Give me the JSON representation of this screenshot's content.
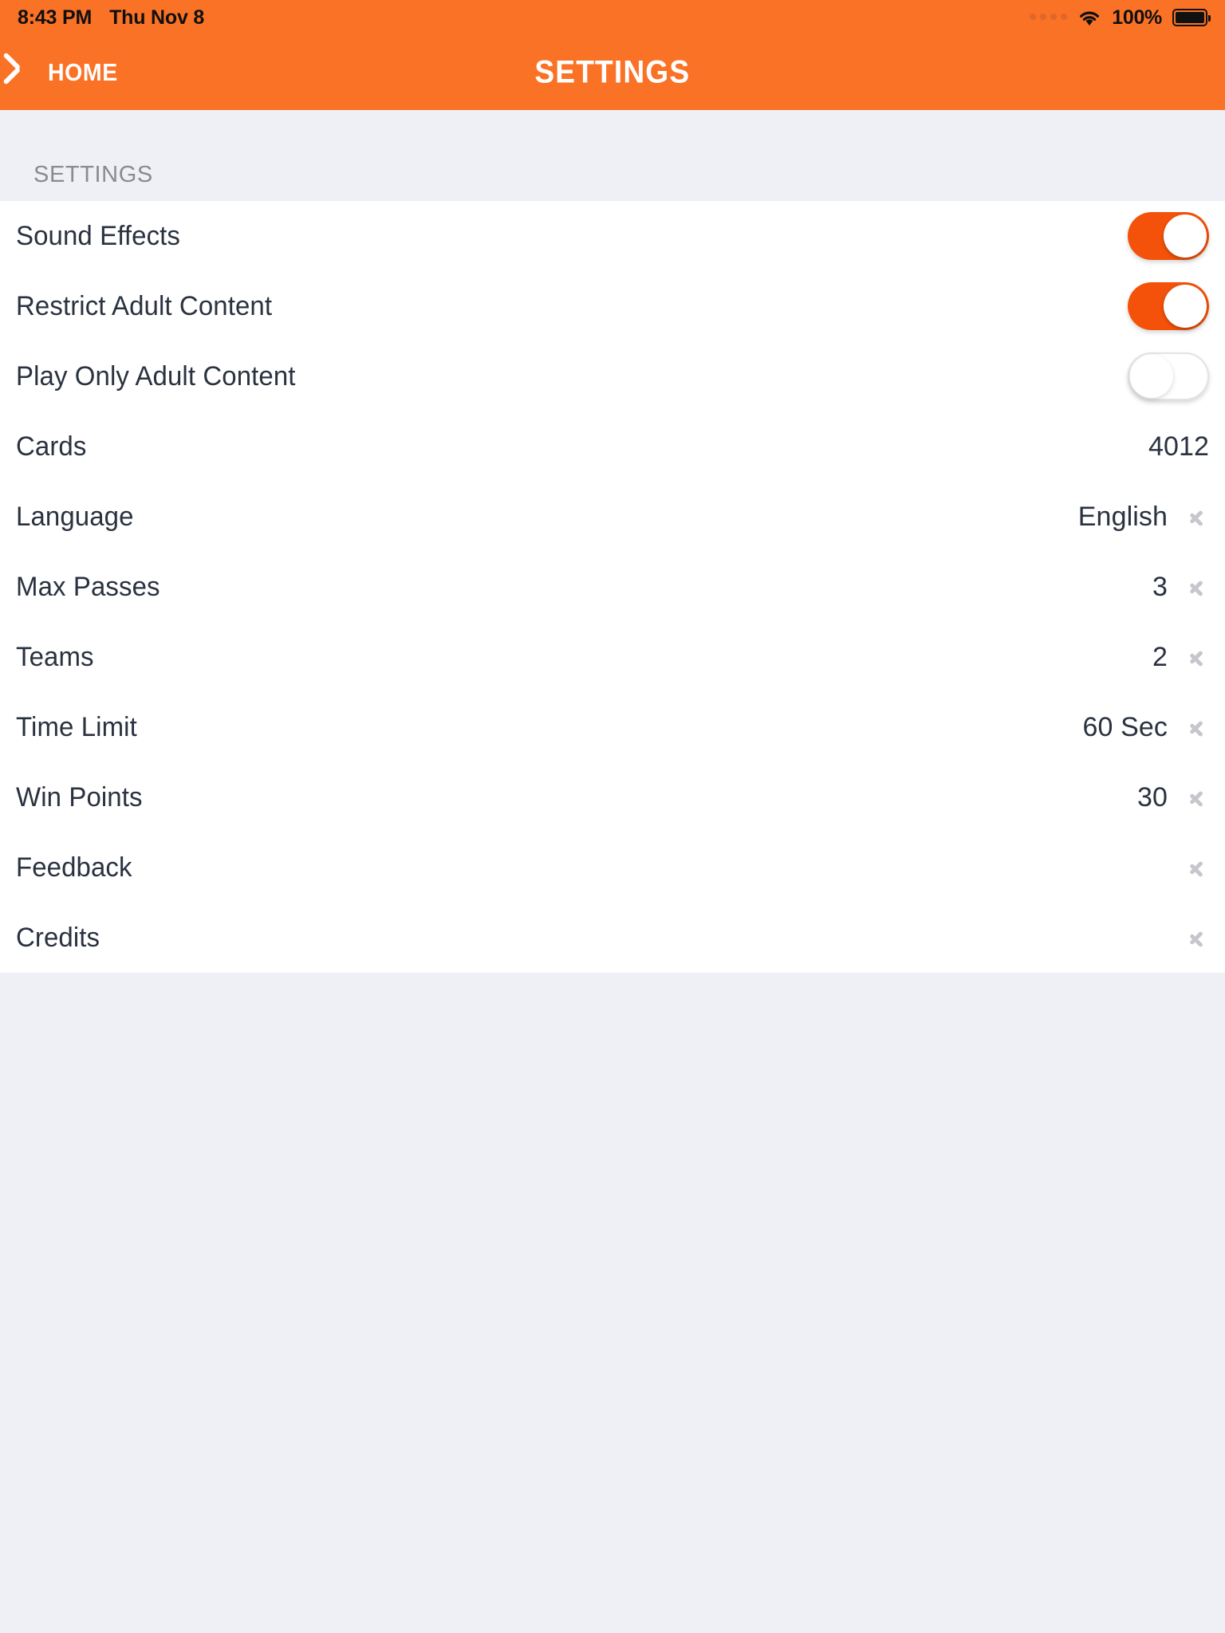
{
  "status_bar": {
    "time": "8:43 PM",
    "date": "Thu Nov 8",
    "battery_percent": "100%",
    "signal_icon": "signal-dots-icon",
    "wifi_icon": "wifi-icon",
    "battery_icon": "battery-full-icon"
  },
  "nav": {
    "back_label": "HOME",
    "back_icon": "chevron-left-icon",
    "title": "SETTINGS"
  },
  "section": {
    "header": "SETTINGS"
  },
  "colors": {
    "accent_orange": "#FA7226",
    "toggle_on": "#F4520A",
    "page_background": "#eff0f5",
    "panel_background": "#ffffff",
    "label_text": "#2a3240",
    "section_header_text": "#8a8a8f",
    "chevron": "#c6c7cc"
  },
  "rows": [
    {
      "label": "Sound Effects",
      "type": "toggle",
      "value": "on"
    },
    {
      "label": "Restrict Adult Content",
      "type": "toggle",
      "value": "on"
    },
    {
      "label": "Play Only Adult Content",
      "type": "toggle",
      "value": "off"
    },
    {
      "label": "Cards",
      "type": "value",
      "value": "4012"
    },
    {
      "label": "Language",
      "type": "nav",
      "value": "English"
    },
    {
      "label": "Max Passes",
      "type": "nav",
      "value": "3"
    },
    {
      "label": "Teams",
      "type": "nav",
      "value": "2"
    },
    {
      "label": "Time Limit",
      "type": "nav",
      "value": "60 Sec"
    },
    {
      "label": "Win Points",
      "type": "nav",
      "value": "30"
    },
    {
      "label": "Feedback",
      "type": "nav",
      "value": ""
    },
    {
      "label": "Credits",
      "type": "nav",
      "value": ""
    }
  ]
}
